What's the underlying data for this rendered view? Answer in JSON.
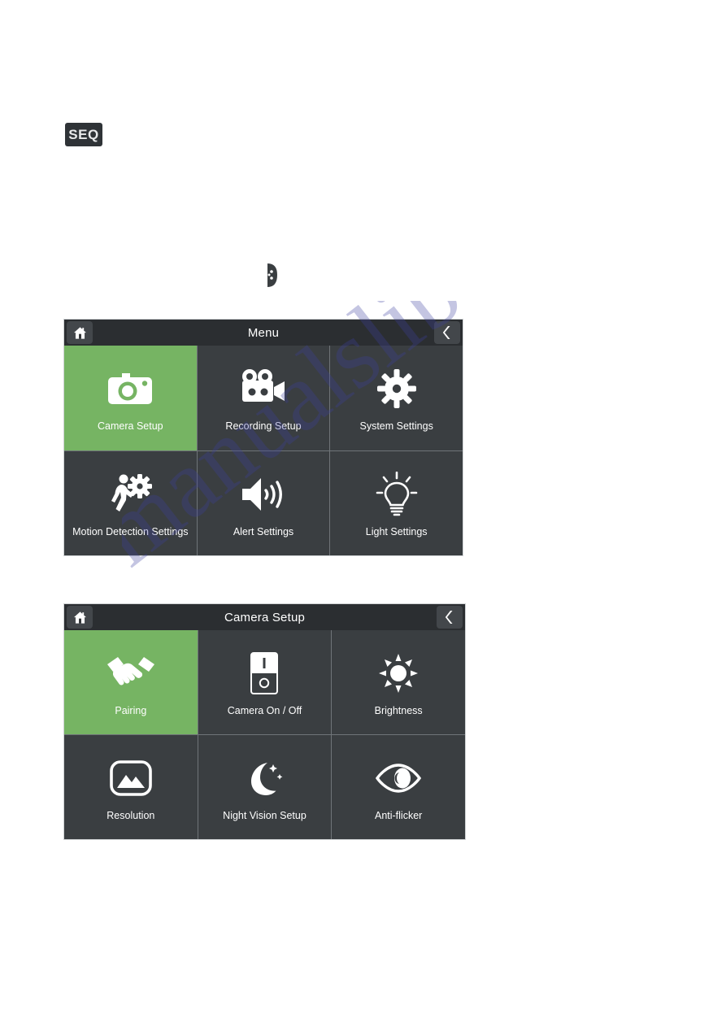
{
  "seq_badge": {
    "label": "SEQ",
    "name": "seq-icon"
  },
  "panels": [
    {
      "id": "panel-menu",
      "header": {
        "title": "Menu",
        "home_icon": "home-icon",
        "back_icon": "back-chevron-icon"
      },
      "tiles": [
        {
          "label": "Camera Setup",
          "icon": "camera-icon",
          "active": true
        },
        {
          "label": "Recording Setup",
          "icon": "video-camera-icon",
          "active": false
        },
        {
          "label": "System Settings",
          "icon": "gear-icon",
          "active": false
        },
        {
          "label": "Motion Detection Settings",
          "icon": "walking-person-gear-icon",
          "active": false
        },
        {
          "label": "Alert Settings",
          "icon": "speaker-waves-icon",
          "active": false
        },
        {
          "label": "Light Settings",
          "icon": "lightbulb-icon",
          "active": false
        }
      ]
    },
    {
      "id": "panel-camera",
      "header": {
        "title": "Camera Setup",
        "home_icon": "home-icon",
        "back_icon": "back-chevron-icon"
      },
      "tiles": [
        {
          "label": "Pairing",
          "icon": "handshake-icon",
          "active": true
        },
        {
          "label": "Camera On / Off",
          "icon": "rocker-switch-icon",
          "active": false
        },
        {
          "label": "Brightness",
          "icon": "sun-icon",
          "active": false
        },
        {
          "label": "Resolution",
          "icon": "picture-icon",
          "active": false
        },
        {
          "label": "Night Vision Setup",
          "icon": "moon-stars-icon",
          "active": false
        },
        {
          "label": "Anti-flicker",
          "icon": "eye-icon",
          "active": false
        }
      ]
    }
  ],
  "watermark": {
    "text": "manualslib.com"
  },
  "colors": {
    "tile_active": "#76b463",
    "tile_inactive": "#3a3e41",
    "header_bar": "#2b2e31",
    "icon": "#ffffff"
  }
}
